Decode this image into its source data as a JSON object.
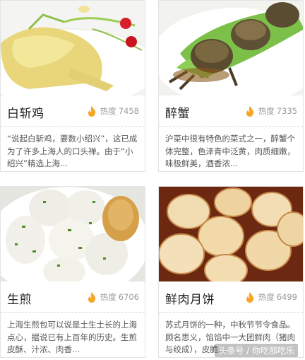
{
  "cards": [
    {
      "title": "白斩鸡",
      "heat_label": "热度",
      "heat_value": "7458",
      "description": "“说起白斩鸡，要数小绍兴”，这已成为了许多上海人的口头禅。由于“小绍兴”精选上海..."
    },
    {
      "title": "醉蟹",
      "heat_label": "热度",
      "heat_value": "7335",
      "description": "沪菜中很有特色的菜式之一，醉蟹个体完整，色泽青中泛黄，肉质细嫩，味极鲜美，酒香浓..."
    },
    {
      "title": "生煎",
      "heat_label": "热度",
      "heat_value": "6706",
      "description": "上海生煎包可以说是土生土长的上海点心，据说已有上百年的历史。生煎皮酥、汁浓、肉香..."
    },
    {
      "title": "鲜肉月饼",
      "heat_label": "热度",
      "heat_value": "6499",
      "description": "苏式月饼的一种，中秋节节令食品。顾名思义，馅馅中一大团鲜肉（猪肉与绞成），皮脆..."
    }
  ],
  "watermark": "头条号 / 你吃那吃乐",
  "colors": {
    "flame": "#f5a623",
    "title": "#222222",
    "meta": "#999999",
    "body": "#555555"
  }
}
